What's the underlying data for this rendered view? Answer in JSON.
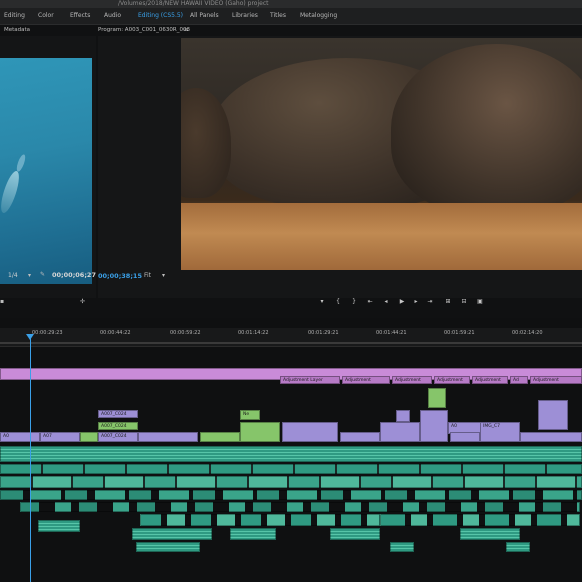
{
  "window": {
    "path_title": "/Volumes/2018/NEW HAWAII VIDEO (Gaho) project"
  },
  "workspace_tabs": [
    {
      "label": "Editing",
      "active": false
    },
    {
      "label": "Color",
      "active": false
    },
    {
      "label": "Effects",
      "active": false
    },
    {
      "label": "Audio",
      "active": false
    },
    {
      "label": "Editing (CS5.5)",
      "active": true
    },
    {
      "label": "All Panels",
      "active": false
    },
    {
      "label": "Libraries",
      "active": false
    },
    {
      "label": "Titles",
      "active": false
    },
    {
      "label": "Metalogging",
      "active": false
    }
  ],
  "source_monitor": {
    "tab_label": "Metadata",
    "zoom": "1/4",
    "timecode": "00;00;06;27"
  },
  "program_monitor": {
    "tab_label": "Program: A003_C001_0630R_003",
    "timecode": "00;00;38;15",
    "fit_label": "Fit"
  },
  "timeline": {
    "ruler_labels": [
      "00:00:29:23",
      "00:00:44:22",
      "00:00:59:22",
      "00:01:14:22",
      "00:01:29:21",
      "00:01:44:21",
      "00:01:59:21",
      "00:02:14:20"
    ],
    "adjustment_label": "Adjustment Layer",
    "adjustment_short": "Adjustment",
    "adjustment_tiny": "Ad",
    "clip_a007_c024": "A007_C024",
    "clip_a07": "A07",
    "clip_a0": "A0",
    "clip_img": "IMG_C7",
    "clip_ne": "Ne"
  },
  "colors": {
    "accent_blue": "#3aa0e8",
    "adjustment_pink": "#c98bd8",
    "video_violet": "#9d8fd6",
    "video_green": "#86c56a",
    "audio_teal": "#39a88f"
  }
}
